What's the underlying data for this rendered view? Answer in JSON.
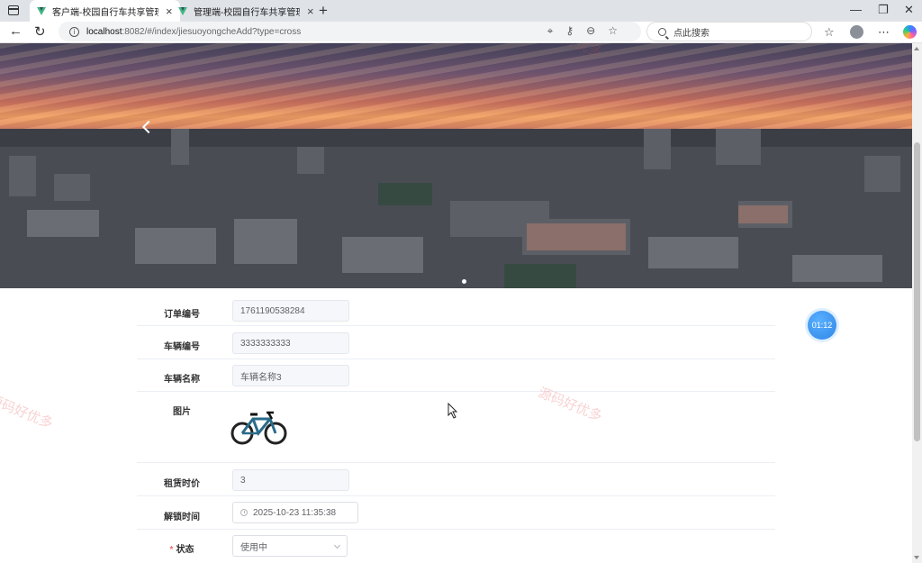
{
  "browser": {
    "tabs": [
      {
        "title": "客户端-校园自行车共享管理系统",
        "active": true
      },
      {
        "title": "管理端-校园自行车共享管理系统",
        "active": false
      }
    ],
    "url_host": "localhost",
    "url_path": ":8082/#/index/jiesuoyongcheAdd?type=cross",
    "search_placeholder": "点此搜索"
  },
  "form": {
    "order_no": {
      "label": "订单编号",
      "value": "1761190538284"
    },
    "bike_no": {
      "label": "车辆编号",
      "value": "3333333333"
    },
    "bike_name": {
      "label": "车辆名称",
      "value": "车辆名称3"
    },
    "image": {
      "label": "图片"
    },
    "price": {
      "label": "租赁时价",
      "value": "3"
    },
    "unlock_time": {
      "label": "解锁时间",
      "value": "2025-10-23 11:35:38"
    },
    "status": {
      "label": "状态",
      "required_mark": "*",
      "value": "使用中"
    }
  },
  "timer": "01:12",
  "watermarks": [
    "源码好优多",
    "源码好优多",
    "源码好优多"
  ],
  "colors": {
    "accent": "#409eff",
    "required": "#f56c6c",
    "vue_green": "#41b883"
  }
}
